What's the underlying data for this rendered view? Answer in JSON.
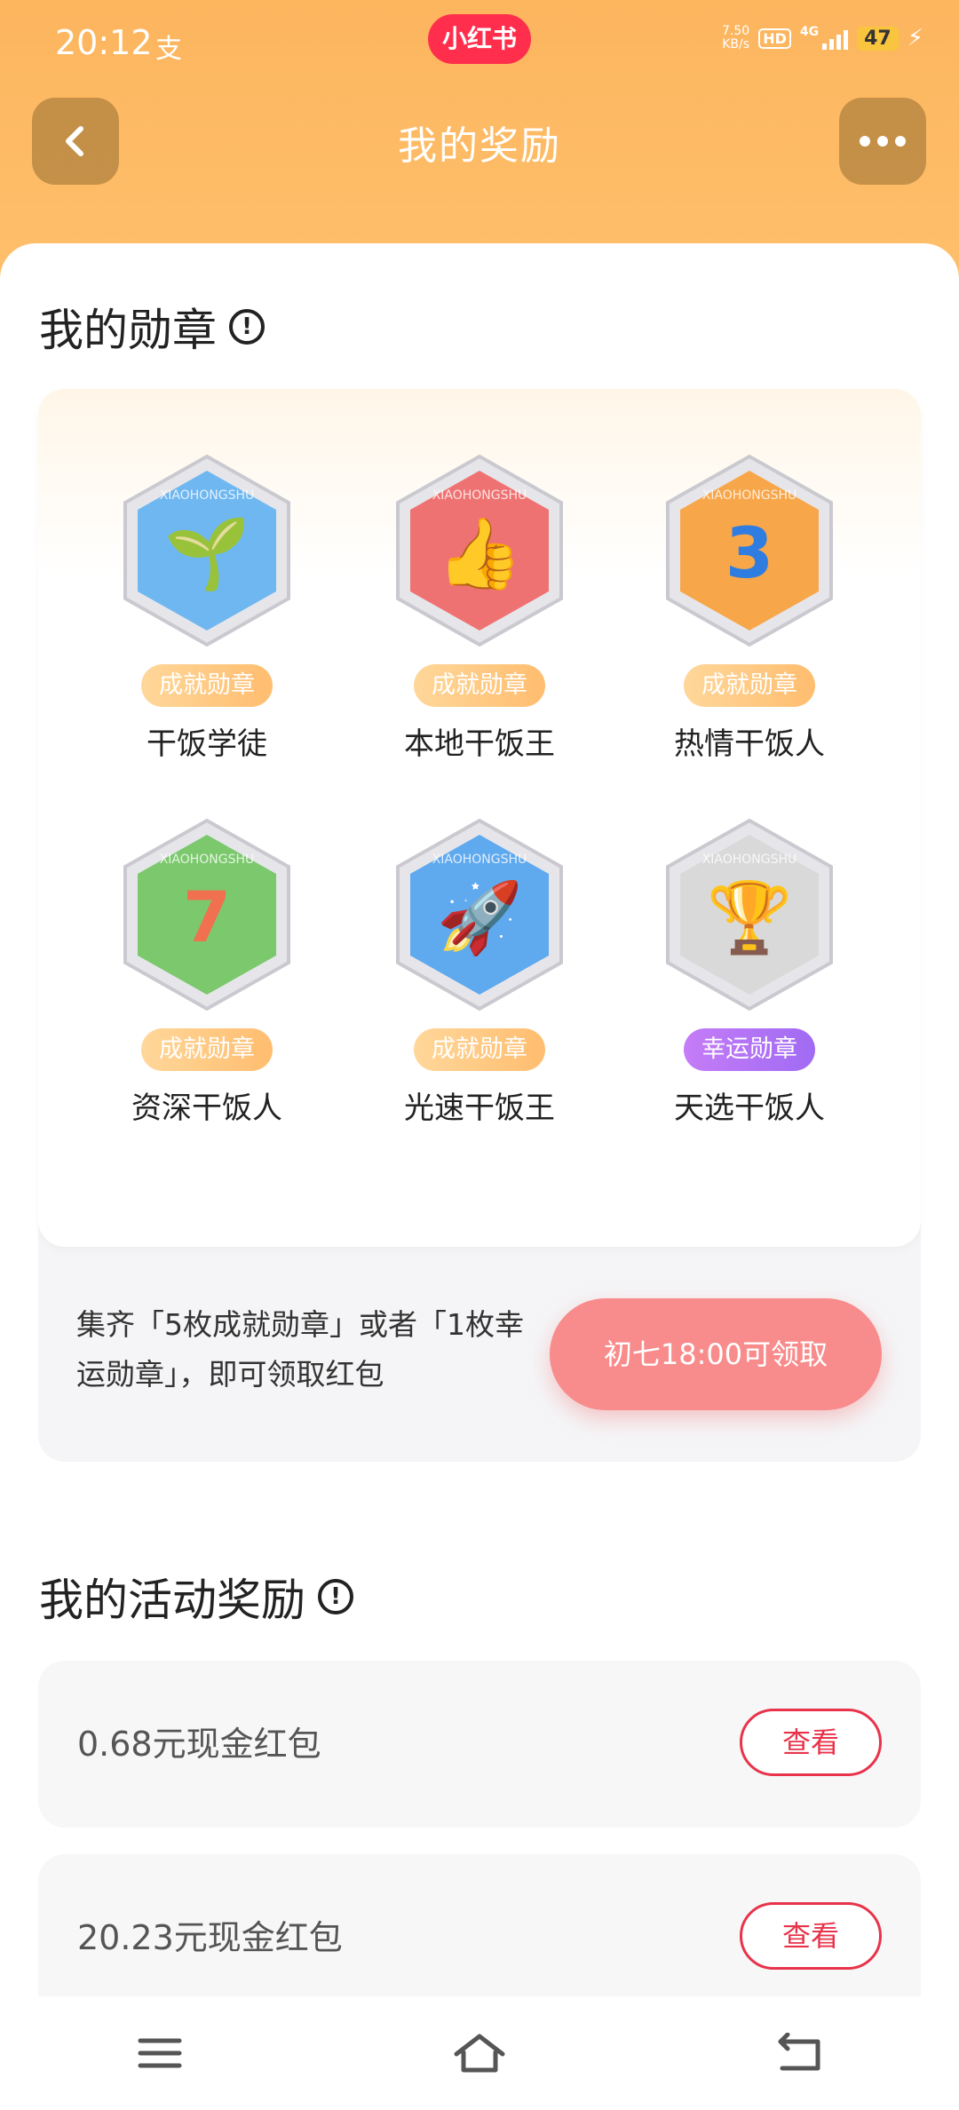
{
  "status_bar": {
    "time": "20:12",
    "notification_icon": "alipay-icon",
    "app_pill": "小红书",
    "net_speed_value": "7.50",
    "net_speed_unit": "KB/s",
    "hd": "HD",
    "network": "4G",
    "battery": "47"
  },
  "header": {
    "title": "我的奖励",
    "back_icon": "chevron-left-icon",
    "more_icon": "more-icon"
  },
  "medals_section": {
    "title": "我的勋章",
    "medals": [
      {
        "tag": "成就勋章",
        "name": "干饭学徒",
        "icon": "sprout-badge",
        "color": "#6fb7f0"
      },
      {
        "tag": "成就勋章",
        "name": "本地干饭王",
        "icon": "thumbs-up-badge",
        "color": "#ef7272"
      },
      {
        "tag": "成就勋章",
        "name": "热情干饭人",
        "icon": "number-3-badge",
        "color": "#f7a64a"
      },
      {
        "tag": "成就勋章",
        "name": "资深干饭人",
        "icon": "number-7-badge",
        "color": "#7cc86d"
      },
      {
        "tag": "成就勋章",
        "name": "光速干饭王",
        "icon": "rocket-badge",
        "color": "#5fa9ef"
      },
      {
        "tag": "幸运勋章",
        "name": "天选干饭人",
        "icon": "trophy-badge",
        "color": "#d9d9d9"
      }
    ],
    "tip": "集齐「5枚成就勋章」或者「1枚幸运勋章」，即可领取红包",
    "claim_button": "初七18:00可领取"
  },
  "activity_section": {
    "title": "我的活动奖励",
    "rewards": [
      {
        "label": "0.68元现金红包",
        "button": "查看"
      },
      {
        "label": "20.23元现金红包",
        "button": "查看"
      }
    ]
  },
  "nav_bar": {
    "menu_icon": "menu-icon",
    "home_icon": "home-icon",
    "back_icon": "back-icon"
  }
}
